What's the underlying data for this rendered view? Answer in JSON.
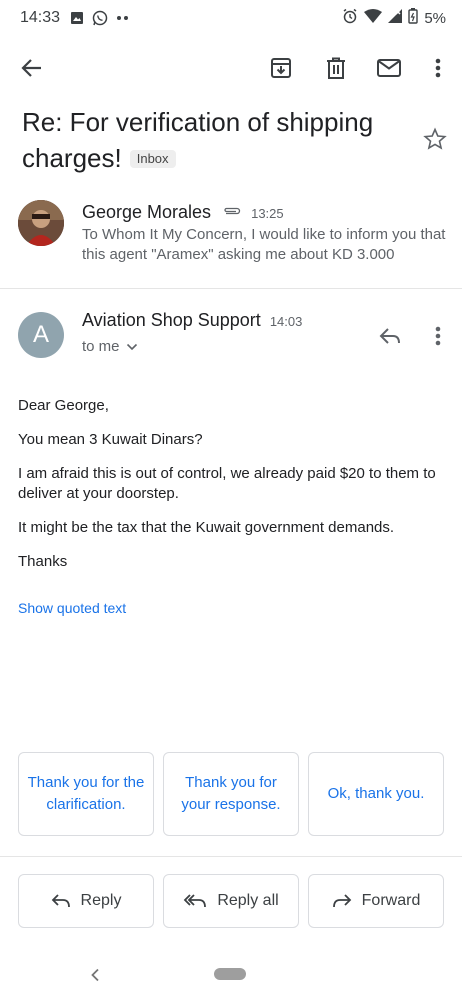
{
  "status_bar": {
    "time": "14:33",
    "battery": "5%",
    "icons_left": [
      "gallery-icon",
      "whatsapp-icon",
      "more-dots-icon"
    ],
    "icons_right": [
      "alarm-icon",
      "wifi-icon",
      "signal-icon",
      "battery-icon"
    ]
  },
  "toolbar": {
    "actions": [
      "back-icon",
      "archive-icon",
      "delete-icon",
      "mark-unread-icon",
      "more-vert-icon"
    ]
  },
  "subject": {
    "text": "Re: For verification of shipping charges!",
    "label": "Inbox"
  },
  "messages": [
    {
      "sender": "George Morales",
      "time": "13:25",
      "has_attachment": true,
      "snippet": "To Whom It My Concern, I would like to inform you that this agent \"Aramex\" asking me about KD 3.000"
    },
    {
      "sender": "Aviation Shop Support",
      "avatar_letter": "A",
      "time": "14:03",
      "recipient": "to me",
      "body": [
        "Dear George,",
        "You mean 3 Kuwait Dinars?",
        "I am afraid this is out of control, we already paid $20 to them to deliver at your doorstep.",
        "It might be the tax that the Kuwait government demands.",
        "Thanks"
      ],
      "show_quoted": "Show quoted text"
    }
  ],
  "smart_replies": [
    "Thank you for the clarification.",
    "Thank you for your response.",
    "Ok, thank you."
  ],
  "actions": {
    "reply": "Reply",
    "reply_all": "Reply all",
    "forward": "Forward"
  },
  "colors": {
    "link": "#1a73e8",
    "avatar": "#90a4ae",
    "text": "#202124",
    "secondary": "#5f6368"
  }
}
